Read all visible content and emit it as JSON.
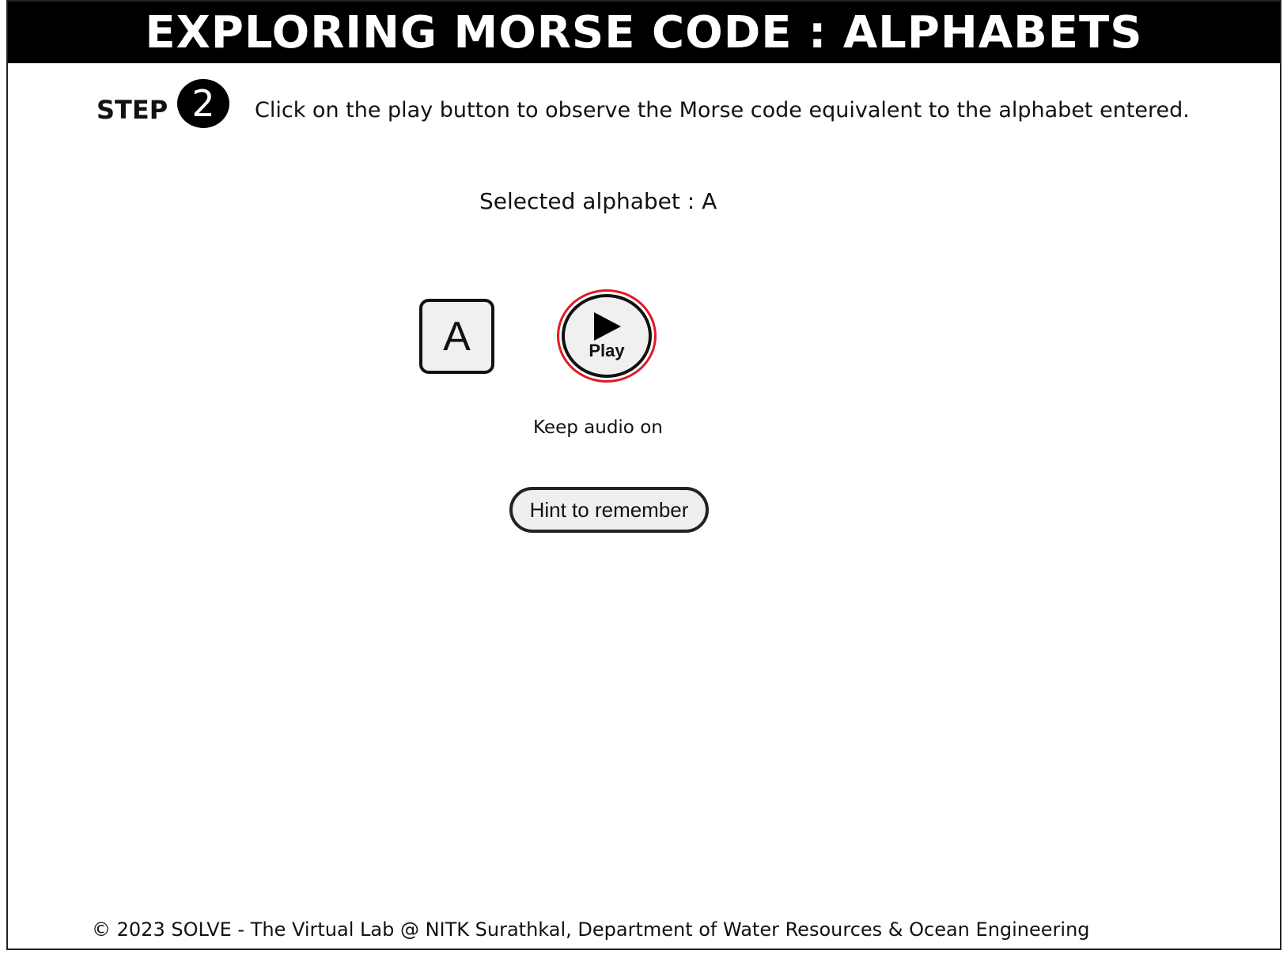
{
  "header": {
    "title": "EXPLORING MORSE CODE : ALPHABETS"
  },
  "step": {
    "label": "STEP",
    "number": "2",
    "instruction": "Click on the play button to observe the Morse code equivalent to the alphabet entered."
  },
  "selection": {
    "text": "Selected alphabet : A",
    "letter": "A"
  },
  "player": {
    "play_label": "Play",
    "play_icon": "play-triangle-icon",
    "highlight_color": "#e01b24"
  },
  "audio_note": "Keep audio on",
  "hint_button": "Hint to remember",
  "footer": "© 2023 SOLVE - The Virtual Lab @ NITK Surathkal, Department of Water Resources & Ocean Engineering",
  "colors": {
    "title_bar_bg": "#000000",
    "title_text": "#ffffff",
    "button_bg": "#f0f0f0"
  }
}
